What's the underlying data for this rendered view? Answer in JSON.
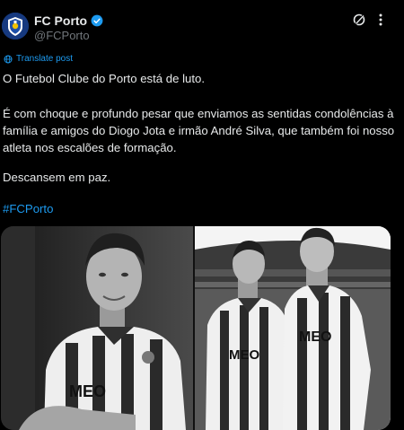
{
  "account": {
    "display_name": "FC Porto",
    "handle": "@FCPorto"
  },
  "translate_label": "Translate post",
  "tweet": {
    "paragraphs": [
      "O Futebol Clube do Porto está de luto.",
      "É com choque e profundo pesar que enviamos as sentidas condolências à família e amigos do Diogo Jota e irmão André Silva, que também foi nosso atleta nos escalões de formação.",
      "Descansem em paz."
    ],
    "hashtag": "#FCPorto"
  },
  "media": {
    "images": [
      {
        "name": "photo-left",
        "style": "black-and-white"
      },
      {
        "name": "photo-right",
        "style": "black-and-white"
      }
    ],
    "shirt_sponsor": "MEO"
  },
  "colors": {
    "background": "#000000",
    "text": "#e7e9ea",
    "muted": "#71767b",
    "link": "#1d9bf0",
    "verified": "#1d9bf0"
  },
  "icons": [
    "verified-badge-icon",
    "grok-icon",
    "more-icon",
    "globe-icon"
  ]
}
